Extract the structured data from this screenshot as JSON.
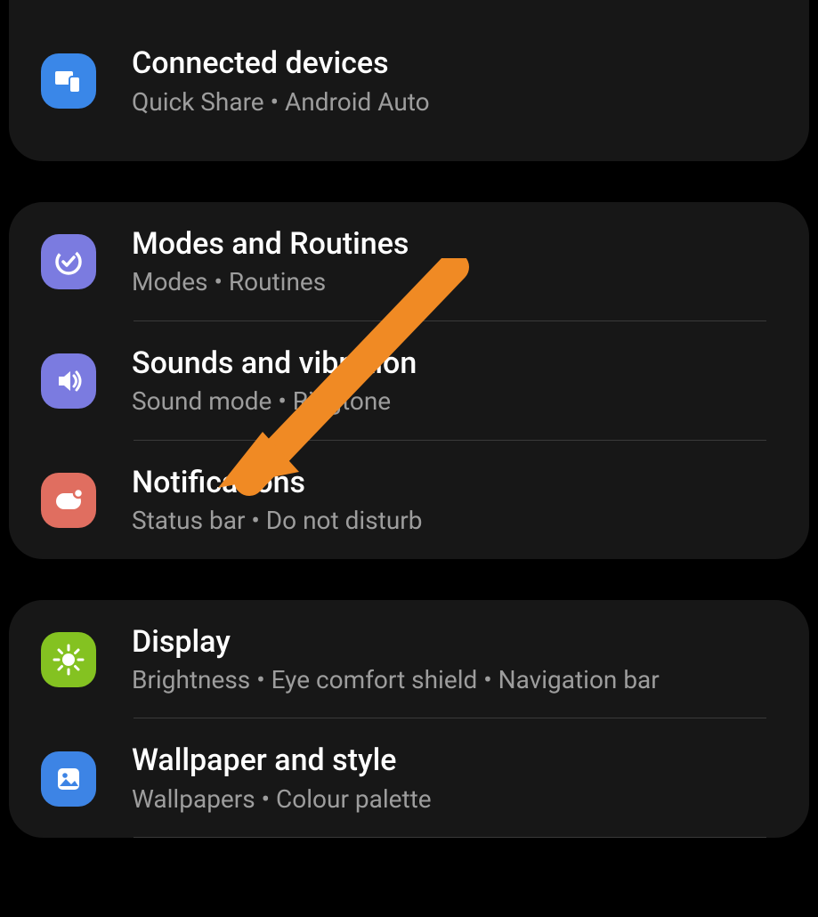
{
  "groups": [
    {
      "items": [
        {
          "id": "connected-devices",
          "title": "Connected devices",
          "subtitle": "Quick Share  •  Android Auto",
          "iconColor": "bg-blue",
          "iconName": "devices-icon"
        }
      ]
    },
    {
      "items": [
        {
          "id": "modes-routines",
          "title": "Modes and Routines",
          "subtitle": "Modes  •  Routines",
          "iconColor": "bg-purple",
          "iconName": "clock-check-icon"
        },
        {
          "id": "sounds-vibration",
          "title": "Sounds and vibration",
          "subtitle": "Sound mode  •  Ringtone",
          "iconColor": "bg-purple",
          "iconName": "speaker-icon"
        },
        {
          "id": "notifications",
          "title": "Notifications",
          "subtitle": "Status bar  •  Do not disturb",
          "iconColor": "bg-red",
          "iconName": "notification-icon"
        }
      ]
    },
    {
      "items": [
        {
          "id": "display",
          "title": "Display",
          "subtitle": "Brightness  •  Eye comfort shield  •  Navigation bar",
          "iconColor": "bg-green",
          "iconName": "brightness-icon"
        },
        {
          "id": "wallpaper-style",
          "title": "Wallpaper and style",
          "subtitle": "Wallpapers  •  Colour palette",
          "iconColor": "bg-blue2",
          "iconName": "image-icon"
        }
      ]
    }
  ],
  "annotation": {
    "arrow_target": "notifications",
    "arrow_color": "#f08a24"
  }
}
